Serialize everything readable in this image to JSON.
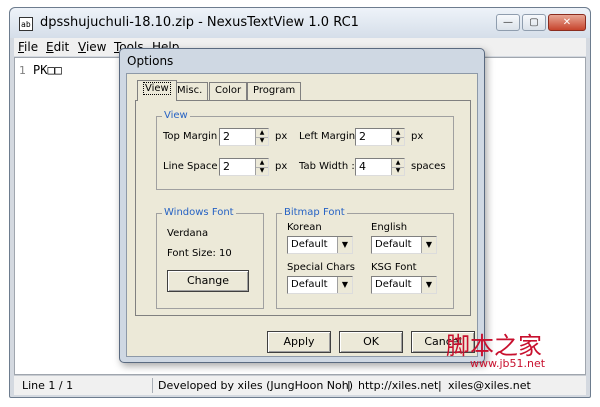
{
  "window": {
    "title": "dpsshujuchuli-18.10.zip - NexusTextView 1.0 RC1",
    "controls": [
      "—",
      "▢",
      "✕"
    ]
  },
  "menu": [
    {
      "label": "File",
      "mnemonic": "F",
      "rest": "ile"
    },
    {
      "label": "Edit",
      "mnemonic": "E",
      "rest": "dit"
    },
    {
      "label": "View",
      "mnemonic": "V",
      "rest": "iew"
    },
    {
      "label": "Tools",
      "mnemonic": "T",
      "rest": "ools"
    },
    {
      "label": "Help",
      "mnemonic": "H",
      "rest": "elp"
    }
  ],
  "editor": {
    "line_number": "1",
    "content": "PK□□"
  },
  "status": {
    "line": "Line 1 / 1",
    "developer": "Developed by xiles (JungHoon Noh)",
    "site": "http://xiles.net",
    "email": "xiles@xiles.net"
  },
  "dialog": {
    "title": "Options",
    "tabs": [
      "View",
      "Misc.",
      "Color",
      "Program"
    ],
    "view_group": {
      "title": "View",
      "top_margin": {
        "label": "Top Margin :",
        "value": "2",
        "unit": "px"
      },
      "left_margin": {
        "label": "Left Margin :",
        "value": "2",
        "unit": "px"
      },
      "line_space": {
        "label": "Line Space :",
        "value": "2",
        "unit": "px"
      },
      "tab_width": {
        "label": "Tab Width :",
        "value": "4",
        "unit": "spaces"
      }
    },
    "windows_font": {
      "title": "Windows Font",
      "font_name": "Verdana",
      "font_size": "Font Size: 10",
      "change_button": "Change"
    },
    "bitmap_font": {
      "title": "Bitmap Font",
      "korean": {
        "label": "Korean",
        "value": "Default"
      },
      "english": {
        "label": "English",
        "value": "Default"
      },
      "special": {
        "label": "Special Chars",
        "value": "Default"
      },
      "ksg": {
        "label": "KSG Font",
        "value": "Default"
      }
    },
    "buttons": {
      "apply": "Apply",
      "ok": "OK",
      "cancel": "Cancel"
    }
  },
  "watermark": {
    "main": "脚本之家",
    "url": "www.jb51.net"
  },
  "colors": {
    "group_title": "#2763c4",
    "dialog_face": "#ece9d8",
    "watermark": "#c8102e"
  }
}
